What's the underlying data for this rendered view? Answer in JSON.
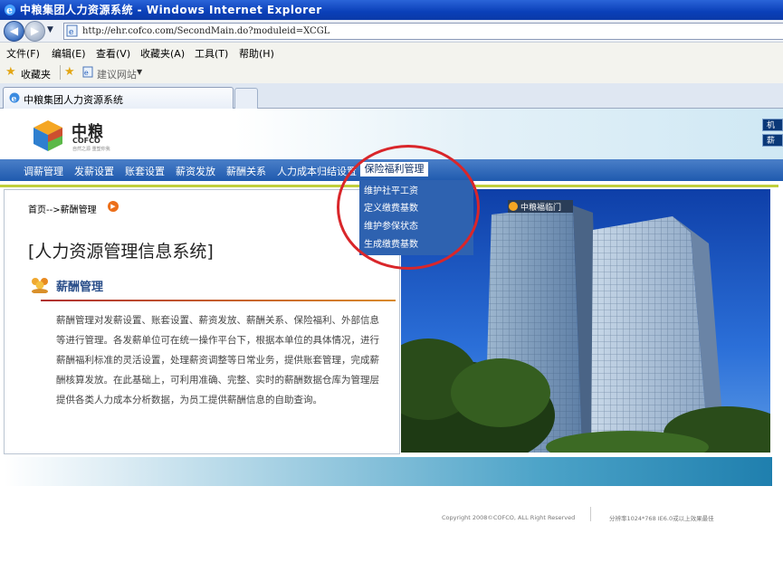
{
  "window": {
    "title": "中粮集团人力资源系统 - Windows Internet Explorer"
  },
  "address_bar": {
    "url": "http://ehr.cofco.com/SecondMain.do?moduleid=XCGL"
  },
  "menu": [
    "文件(F)",
    "编辑(E)",
    "查看(V)",
    "收藏夹(A)",
    "工具(T)",
    "帮助(H)"
  ],
  "favorites_bar": {
    "favorites_label": "收藏夹",
    "suggested_sites": "建议网站"
  },
  "tab": {
    "label": "中粮集团人力资源系统"
  },
  "header": {
    "logo_cn": "中粮",
    "logo_en": "COFCO",
    "logo_tagline": "自然之源 重塑你我",
    "side_buttons": [
      "机",
      "薪"
    ]
  },
  "nav": {
    "items": [
      "调薪管理",
      "发薪设置",
      "账套设置",
      "薪资发放",
      "薪酬关系",
      "人力成本归结设置"
    ],
    "active": "保险福利管理",
    "submenu": [
      "维护社平工资",
      "定义缴费基数",
      "维护参保状态",
      "生成缴费基数"
    ]
  },
  "content": {
    "breadcrumb": "首页-->薪酬管理",
    "system_title": "[人力资源管理信息系统]",
    "section_title": "薪酬管理",
    "description": "薪酬管理对发薪设置、账套设置、薪资发放、薪酬关系、保险福利、外部信息等进行管理。各发薪单位可在统一操作平台下，根据本单位的具体情况，进行薪酬福利标准的灵活设置，处理薪资调整等日常业务，提供账套管理，完成薪酬核算发放。在此基础上，可利用准确、完整、实时的薪酬数据仓库为管理层提供各类人力成本分析数据，为员工提供薪酬信息的自助查询。"
  },
  "photo": {
    "building_sign": "中粮福临门"
  },
  "footer": {
    "copyright": "Copyright 2008©COFCO, ALL Right Reserved",
    "resolution_note": "分辨率1024*768 IE6.0或以上效果最佳"
  },
  "colors": {
    "nav_blue": "#1f5aae",
    "dropdown_blue": "#2e62b0",
    "highlight_red": "#d9262a",
    "accent_green": "#c0cf3c"
  }
}
